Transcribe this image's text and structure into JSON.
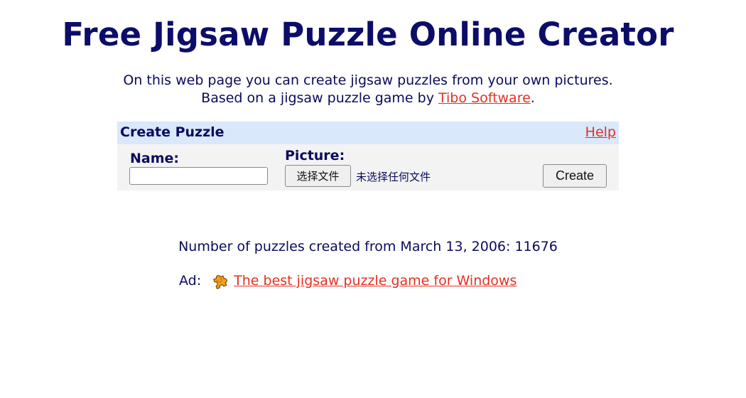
{
  "header": {
    "title": "Free Jigsaw Puzzle Online Creator"
  },
  "intro": {
    "line1": "On this web page you can create jigsaw puzzles from your own pictures.",
    "line2_prefix": "Based on a jigsaw puzzle game by ",
    "line2_link": "Tibo Software",
    "line2_suffix": "."
  },
  "form": {
    "title": "Create Puzzle",
    "help_label": "Help",
    "name_label": "Name:",
    "name_value": "",
    "picture_label": "Picture:",
    "file_button_label": "选择文件",
    "file_status": "未选择任何文件",
    "create_label": "Create"
  },
  "stats": {
    "counter_text": "Number of puzzles created from March 13, 2006: 11676"
  },
  "ad": {
    "label": "Ad:",
    "icon": "puzzle-piece-icon",
    "link_text": "The best jigsaw puzzle game for Windows"
  },
  "colors": {
    "title": "#0c0c6a",
    "text": "#0b0b5c",
    "link": "#e53022",
    "panel_header": "#d9e8fb",
    "panel_body": "#f3f3f3"
  }
}
